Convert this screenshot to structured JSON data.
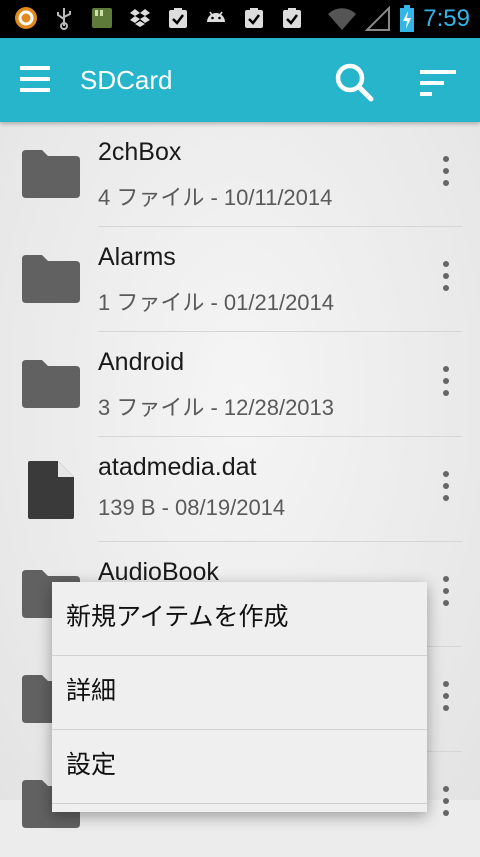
{
  "status_bar": {
    "time": "7:59",
    "left_icons": [
      "notification-circle-icon",
      "usb-icon",
      "sd-card-icon",
      "dropbox-icon",
      "clipboard-check-icon",
      "android-icon",
      "clipboard-check-icon",
      "clipboard-check-icon"
    ],
    "right_icons": [
      "wifi-icon",
      "signal-icon",
      "battery-icon"
    ]
  },
  "toolbar": {
    "title": "SDCard",
    "menu_icon": "hamburger-menu-icon",
    "search_icon": "search-icon",
    "sort_icon": "sort-icon",
    "color": "#26b5cb"
  },
  "files": [
    {
      "name": "2chBox",
      "meta": "4 ファイル - 10/11/2014",
      "type": "folder"
    },
    {
      "name": "Alarms",
      "meta": "1 ファイル - 01/21/2014",
      "type": "folder"
    },
    {
      "name": "Android",
      "meta": "3 ファイル - 12/28/2013",
      "type": "folder"
    },
    {
      "name": "atadmedia.dat",
      "meta": "139 B - 08/19/2014",
      "type": "file"
    },
    {
      "name": "AudioBook",
      "meta": "",
      "type": "folder"
    },
    {
      "name": "",
      "meta": "",
      "type": "folder"
    },
    {
      "name": "",
      "meta": "",
      "type": "folder"
    }
  ],
  "popup_menu": {
    "items": [
      "新規アイテムを作成",
      "詳細",
      "設定"
    ]
  }
}
